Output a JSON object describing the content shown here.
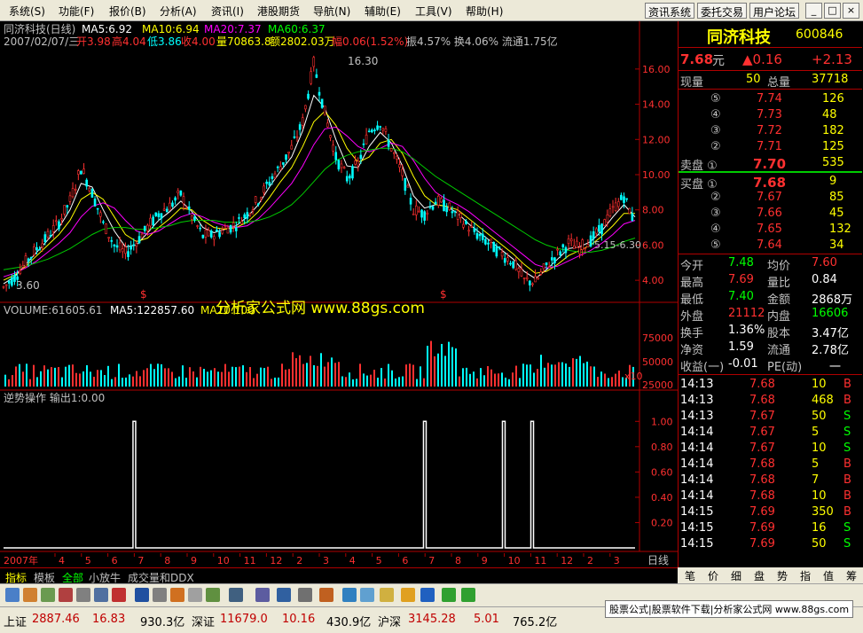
{
  "menu": [
    "系统(S)",
    "功能(F)",
    "报价(B)",
    "分析(A)",
    "资讯(I)",
    "港股期货",
    "导航(N)",
    "辅助(E)",
    "工具(V)",
    "帮助(H)"
  ],
  "top_buttons": [
    "资讯系统",
    "委托交易",
    "用户论坛"
  ],
  "window_buttons": [
    "_",
    "□",
    "×"
  ],
  "chart_header": {
    "stock_line": "同济科技(日线)",
    "ma5": "MA5:6.92",
    "ma10": "MA10:6.94",
    "ma20": "MA20:7.37",
    "ma60": "MA60:6.37",
    "info_date": "2007/02/07/三",
    "info_open": "开3.98",
    "info_high": "高4.04",
    "info_low": "低3.86",
    "info_close": "收4.00",
    "info_vol": "量70863.8",
    "info_amt": "额2802.03万",
    "info_chg": "幅0.06(1.52%)",
    "info_rest": "振4.57% 换4.06% 流通1.75亿",
    "max_label": "16.30",
    "min_label": "3.60",
    "mid_label": "5.15-6.30",
    "watermark": "分析家公式网 www.88gs.com",
    "vol_header": "VOLUME:61605.61",
    "vol_ma5": "MA5:122857.60",
    "vol_ma10": "MA10:100",
    "indicator_header": "逆势操作  输出1:0.00",
    "s_markers": [
      "$",
      "$"
    ],
    "x_label_left": "2007年",
    "x_label_right": "日线"
  },
  "chart_data": {
    "type": "line",
    "price_axis": {
      "ticks": [
        "16.00",
        "14.00",
        "12.00",
        "10.00",
        "8.00",
        "6.00",
        "4.00"
      ],
      "ylim": [
        3.0,
        17.0
      ]
    },
    "volume_axis": {
      "ticks": [
        "75000",
        "50000",
        "25000",
        "x10"
      ]
    },
    "indicator_axis": {
      "ticks": [
        "1.00",
        "0.80",
        "0.60",
        "0.40",
        "0.20"
      ],
      "ylim": [
        0,
        1.1
      ]
    },
    "x_ticks": [
      "4",
      "5",
      "6",
      "7",
      "8",
      "9",
      "10",
      "11",
      "12",
      "2",
      "3",
      "4",
      "5",
      "6",
      "7",
      "8",
      "9",
      "10",
      "11",
      "12",
      "2",
      "3"
    ],
    "price_path": [
      3.6,
      4.2,
      5.0,
      5.8,
      6.5,
      7.3,
      8.5,
      10.4,
      9.0,
      7.2,
      6.0,
      5.5,
      6.2,
      7.0,
      7.8,
      8.2,
      8.9,
      7.6,
      6.5,
      6.6,
      6.9,
      7.2,
      7.8,
      8.6,
      9.6,
      10.5,
      11.5,
      13.0,
      16.3,
      13.5,
      11.0,
      9.8,
      10.6,
      12.5,
      13.0,
      11.5,
      10.0,
      8.0,
      7.8,
      8.5,
      8.2,
      7.6,
      7.0,
      6.5,
      6.0,
      5.5,
      5.0,
      4.0,
      3.9,
      4.8,
      5.5,
      6.1,
      5.8,
      6.3,
      7.0,
      8.0,
      8.8,
      7.2
    ],
    "ma_series": [
      {
        "name": "MA5",
        "color": "#ffffff",
        "values": [
          3.8,
          4.2,
          4.9,
          5.6,
          6.3,
          7.0,
          8.0,
          9.5,
          9.3,
          8.0,
          6.8,
          5.9,
          6.0,
          6.7,
          7.4,
          7.9,
          8.5,
          7.9,
          7.0,
          6.7,
          6.9,
          7.1,
          7.6,
          8.3,
          9.3,
          10.2,
          11.0,
          12.5,
          14.5,
          13.8,
          12.0,
          10.5,
          10.4,
          11.6,
          12.4,
          11.8,
          10.5,
          8.8,
          8.1,
          8.3,
          8.2,
          7.8,
          7.2,
          6.7,
          6.2,
          5.7,
          5.2,
          4.5,
          4.1,
          4.6,
          5.2,
          5.8,
          5.9,
          6.2,
          6.8,
          7.6,
          8.3,
          7.6
        ]
      },
      {
        "name": "MA10",
        "color": "#ffff00",
        "values": [
          4.0,
          4.3,
          4.8,
          5.4,
          6.0,
          6.6,
          7.4,
          8.6,
          9.0,
          8.6,
          7.6,
          6.6,
          6.2,
          6.4,
          7.0,
          7.5,
          8.1,
          8.0,
          7.4,
          7.0,
          6.9,
          7.0,
          7.3,
          7.9,
          8.7,
          9.6,
          10.4,
          11.6,
          13.0,
          13.6,
          12.8,
          11.5,
          10.7,
          11.0,
          11.8,
          12.0,
          11.2,
          9.9,
          8.8,
          8.3,
          8.2,
          8.0,
          7.5,
          7.0,
          6.5,
          6.0,
          5.5,
          4.9,
          4.4,
          4.5,
          4.9,
          5.4,
          5.7,
          6.0,
          6.5,
          7.1,
          7.8,
          7.8
        ]
      },
      {
        "name": "MA20",
        "color": "#ff00ff",
        "values": [
          4.2,
          4.4,
          4.7,
          5.1,
          5.6,
          6.1,
          6.7,
          7.6,
          8.2,
          8.4,
          8.1,
          7.4,
          6.8,
          6.6,
          6.8,
          7.2,
          7.6,
          7.8,
          7.6,
          7.3,
          7.1,
          7.0,
          7.1,
          7.5,
          8.1,
          8.8,
          9.5,
          10.5,
          11.7,
          12.6,
          12.7,
          12.2,
          11.6,
          11.3,
          11.5,
          11.8,
          11.6,
          10.8,
          9.8,
          9.0,
          8.6,
          8.3,
          7.9,
          7.4,
          6.9,
          6.4,
          5.9,
          5.4,
          4.9,
          4.7,
          4.8,
          5.1,
          5.4,
          5.7,
          6.1,
          6.6,
          7.2,
          7.4
        ]
      },
      {
        "name": "MA60",
        "color": "#00cc00",
        "values": [
          4.6,
          4.7,
          4.8,
          5.0,
          5.2,
          5.5,
          5.8,
          6.2,
          6.6,
          6.9,
          7.0,
          7.0,
          6.9,
          6.9,
          7.0,
          7.1,
          7.3,
          7.4,
          7.4,
          7.4,
          7.3,
          7.3,
          7.3,
          7.4,
          7.6,
          7.9,
          8.3,
          8.9,
          9.6,
          10.3,
          10.8,
          11.1,
          11.3,
          11.4,
          11.5,
          11.5,
          11.3,
          10.9,
          10.4,
          9.9,
          9.5,
          9.1,
          8.7,
          8.3,
          7.9,
          7.5,
          7.1,
          6.7,
          6.3,
          6.0,
          5.8,
          5.7,
          5.6,
          5.6,
          5.7,
          5.9,
          6.2,
          6.4
        ]
      }
    ],
    "indicator_spikes": [
      0.205,
      0.665,
      0.79,
      0.835
    ]
  },
  "quote": {
    "name": "同济科技",
    "code": "600846",
    "price": "7.68",
    "unit": "元",
    "change": "▲0.16",
    "pct": "+2.13",
    "now_vol_label": "现量",
    "now_vol": "50",
    "total_vol_label": "总量",
    "total_vol": "37718",
    "asks": [
      {
        "lv": "⑤",
        "p": "7.74",
        "v": "126"
      },
      {
        "lv": "④",
        "p": "7.73",
        "v": "48"
      },
      {
        "lv": "③",
        "p": "7.72",
        "v": "182"
      },
      {
        "lv": "②",
        "p": "7.71",
        "v": "125"
      },
      {
        "lv": "卖盘 ①",
        "p": "7.70",
        "v": "535"
      }
    ],
    "bids": [
      {
        "lv": "买盘 ①",
        "p": "7.68",
        "v": "9"
      },
      {
        "lv": "②",
        "p": "7.67",
        "v": "85"
      },
      {
        "lv": "③",
        "p": "7.66",
        "v": "45"
      },
      {
        "lv": "④",
        "p": "7.65",
        "v": "132"
      },
      {
        "lv": "⑤",
        "p": "7.64",
        "v": "34"
      }
    ],
    "stats": [
      {
        "l1": "今开",
        "v1": "7.48",
        "l2": "均价",
        "v2": "7.60"
      },
      {
        "l1": "最高",
        "v1": "7.69",
        "l2": "量比",
        "v2": "0.84"
      },
      {
        "l1": "最低",
        "v1": "7.40",
        "l2": "金额",
        "v2": "2868万"
      },
      {
        "l1": "外盘",
        "v1": "21112",
        "l2": "内盘",
        "v2": "16606"
      },
      {
        "l1": "换手",
        "v1": "1.36%",
        "l2": "股本",
        "v2": "3.47亿"
      },
      {
        "l1": "净资",
        "v1": "1.59",
        "l2": "流通",
        "v2": "2.78亿"
      },
      {
        "l1": "收益(一)",
        "v1": "-0.01",
        "l2": "PE(动)",
        "v2": "一"
      }
    ],
    "ticks": [
      {
        "t": "14:13",
        "p": "7.68",
        "v": "10",
        "d": "B"
      },
      {
        "t": "14:13",
        "p": "7.68",
        "v": "468",
        "d": "B"
      },
      {
        "t": "14:13",
        "p": "7.67",
        "v": "50",
        "d": "S"
      },
      {
        "t": "14:14",
        "p": "7.67",
        "v": "5",
        "d": "S"
      },
      {
        "t": "14:14",
        "p": "7.67",
        "v": "10",
        "d": "S"
      },
      {
        "t": "14:14",
        "p": "7.68",
        "v": "5",
        "d": "B"
      },
      {
        "t": "14:14",
        "p": "7.68",
        "v": "7",
        "d": "B"
      },
      {
        "t": "14:14",
        "p": "7.68",
        "v": "10",
        "d": "B"
      },
      {
        "t": "14:15",
        "p": "7.69",
        "v": "350",
        "d": "B"
      },
      {
        "t": "14:15",
        "p": "7.69",
        "v": "16",
        "d": "S"
      },
      {
        "t": "14:15",
        "p": "7.69",
        "v": "50",
        "d": "S"
      }
    ]
  },
  "side_tabs": [
    "笔",
    "价",
    "细",
    "盘",
    "势",
    "指",
    "值",
    "筹"
  ],
  "bottom_tabs": [
    "指标",
    "模板",
    "全部",
    "小放牛",
    "成交量和DDX"
  ],
  "status": {
    "sh_label": "上证",
    "sh_val": "2887.46",
    "sh_chg": "16.83",
    "sh_amt": "930.3亿",
    "sz_label": "深证",
    "sz_val": "11679.0",
    "sz_chg": "10.16",
    "sz_amt": "430.9亿",
    "hs_label": "沪深",
    "hs_val": "3145.28",
    "hs_chg": "5.01",
    "hs_amt": "765.2亿",
    "ad": "股票公式|股票软件下载|分析家公式网 www.88gs.com"
  },
  "colors": {
    "up": "#ff3030",
    "down": "#00ffff",
    "accent": "#ffff00",
    "green": "#00ff00"
  }
}
